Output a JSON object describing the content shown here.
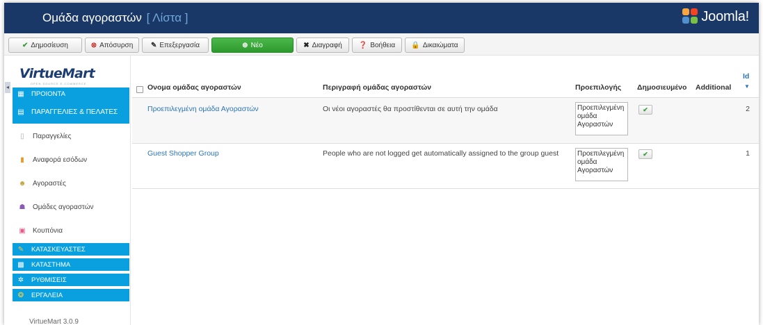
{
  "header": {
    "title": "Ομάδα αγοραστών",
    "subtitle": "[ Λίστα ]",
    "brand": "Joomla!"
  },
  "toolbar": {
    "publish": "Δημοσίευση",
    "unpublish": "Απόσυρση",
    "edit": "Επεξεργασία",
    "new": "Νέο",
    "delete": "Διαγραφή",
    "help": "Βοήθεια",
    "permissions": "Δικαιώματα"
  },
  "sidebar": {
    "logo": "VirtueMart",
    "logo_tagline": "OPEN SOURCE E-COMMERCE",
    "categories": [
      {
        "label": "ΠΡΟΙΟΝΤΑ",
        "icon": "products-icon"
      },
      {
        "label": "ΠΑΡΑΓΓΕΛΙΕΣ & ΠΕΛΑΤΕΣ",
        "icon": "orders-icon"
      },
      {
        "label": "ΚΑΤΑΣΚΕΥΑΣΤΕΣ",
        "icon": "wrench-icon"
      },
      {
        "label": "ΚΑΤΑΣΤΗΜΑ",
        "icon": "store-icon"
      },
      {
        "label": "ΡΥΘΜΙΣΕΙΣ",
        "icon": "settings-icon"
      },
      {
        "label": "ΕΡΓΑΛΕΙΑ",
        "icon": "tools-icon"
      }
    ],
    "items": [
      {
        "label": "Παραγγελίες",
        "icon": "document-icon"
      },
      {
        "label": "Αναφορά εσόδων",
        "icon": "bar-chart-icon"
      },
      {
        "label": "Αγοραστές",
        "icon": "users-icon"
      },
      {
        "label": "Ομάδες αγοραστών",
        "icon": "group-icon"
      },
      {
        "label": "Κουπόνια",
        "icon": "gift-icon"
      }
    ],
    "version": "VirtueMart 3.0.9"
  },
  "table": {
    "headers": {
      "name": "Ονομα ομάδας αγοραστών",
      "description": "Περιγραφή ομάδας αγοραστών",
      "default": "Προεπιλογής",
      "published": "Δημοσιευμένο",
      "additional": "Additional",
      "id": "Id"
    },
    "rows": [
      {
        "name": "Προεπιλεγμένη ομάδα Αγοραστών",
        "description": "Οι νέοι αγοραστές θα προστίθενται σε αυτή την ομάδα",
        "default": "Προεπιλεγμένη\nομάδα\nΑγοραστών",
        "published": true,
        "id": "2"
      },
      {
        "name": "Guest Shopper Group",
        "description": "People who are not logged get automatically assigned to the group guest",
        "default": "Προεπιλεγμένη\nομάδα\nΑγοραστών",
        "published": true,
        "id": "1"
      }
    ]
  },
  "colors": {
    "header_bg": "#1a3867",
    "accent": "#0aa0df",
    "link": "#2b74b8",
    "new_button": "#3aa93a"
  }
}
